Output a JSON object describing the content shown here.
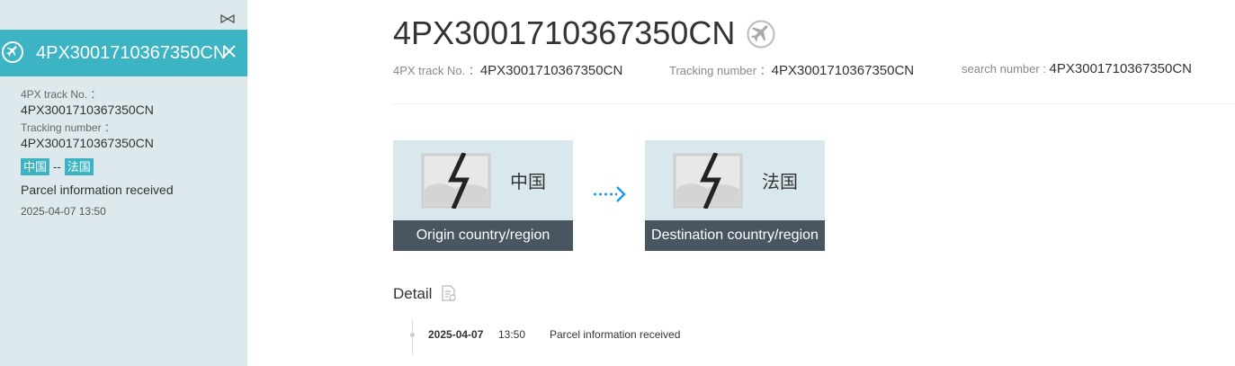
{
  "sidebar": {
    "card_title": "4PX3001710367350CN",
    "track_label": "4PX track No. ：",
    "track_value": "4PX3001710367350CN",
    "tracking_label": "Tracking number ：",
    "tracking_value": "4PX3001710367350CN",
    "origin_tag": "中国",
    "route_sep": "--",
    "dest_tag": "法国",
    "status": "Parcel information received",
    "timestamp": "2025-04-07 13:50"
  },
  "main": {
    "title": "4PX3001710367350CN",
    "meta": [
      {
        "label": "4PX track No. ：",
        "value": "4PX3001710367350CN"
      },
      {
        "label": "Tracking number ：",
        "value": "4PX3001710367350CN"
      },
      {
        "label": "search number : ",
        "value": "4PX3001710367350CN"
      }
    ],
    "origin": {
      "name": "中国",
      "bar": "Origin country/region"
    },
    "destination": {
      "name": "法国",
      "bar": "Destination country/region"
    },
    "detail_title": "Detail",
    "events": [
      {
        "date": "2025-04-07",
        "time": "13:50",
        "desc": "Parcel information received"
      }
    ]
  },
  "colors": {
    "accent": "#3cb4c3",
    "sidebar_bg": "#dde9ec",
    "bar_bg": "#4a5562",
    "arrow": "#1e9be0"
  }
}
